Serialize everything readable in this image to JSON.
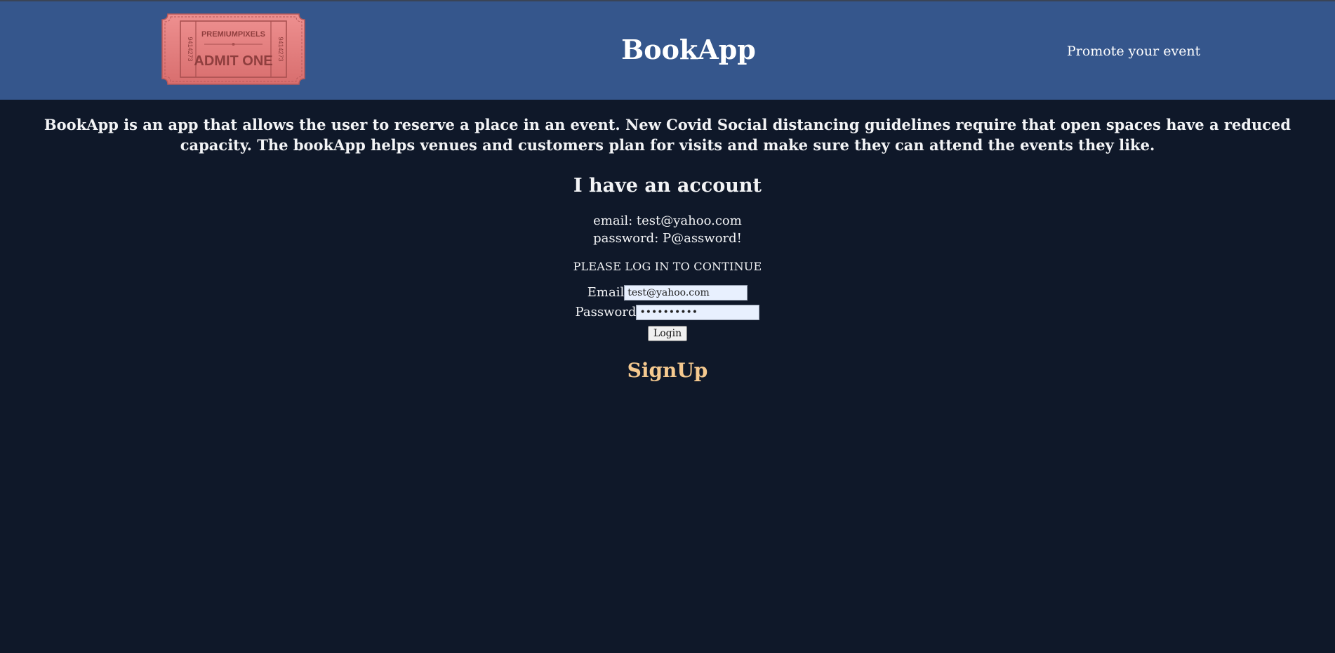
{
  "header": {
    "logo": {
      "top_text": "PREMIUMPIXELS",
      "main_text": "ADMIT ONE",
      "serial_left": "9414273",
      "serial_right": "9414273",
      "color": "#e98383"
    },
    "brand": "BookApp",
    "promote_link": "Promote your event"
  },
  "intro": "BookApp is an app that allows the user to reserve a place in an event. New Covid Social distancing guidelines require that open spaces have a reduced capacity. The bookApp helps venues and customers plan for visits and make sure they can attend the events they like.",
  "account": {
    "title": "I have an account",
    "email_line": "email: test@yahoo.com",
    "password_line": "password: P@assword!"
  },
  "login_form": {
    "prompt": "PLEASE LOG IN TO CONTINUE",
    "email_label": "Email",
    "email_value": "test@yahoo.com",
    "password_label": "Password",
    "password_value": "••••••••••",
    "login_button": "Login"
  },
  "signup_link": "SignUp",
  "colors": {
    "background": "#0f1829",
    "header": "#35568c",
    "signup": "#f5c98f"
  }
}
